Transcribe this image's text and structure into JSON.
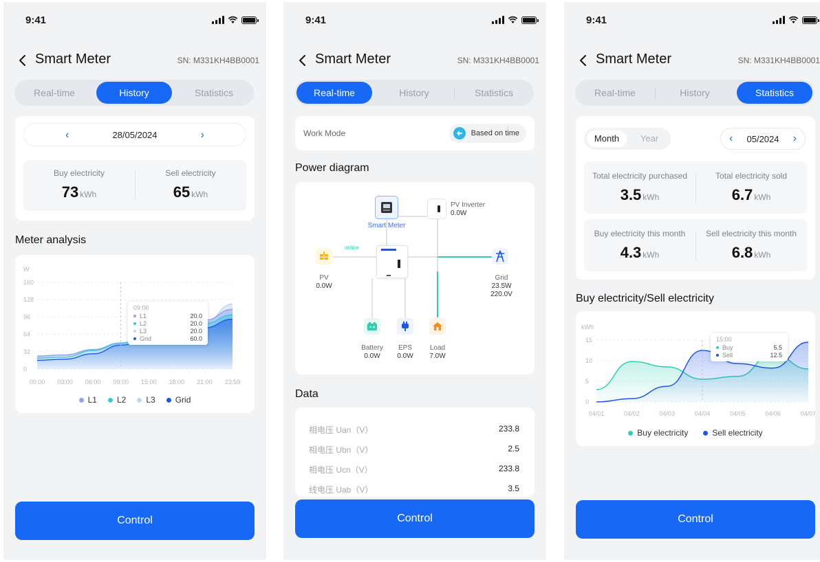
{
  "status": {
    "time": "9:41"
  },
  "header": {
    "title": "Smart Meter",
    "sn": "SN: M331KH4BB0001"
  },
  "tabs": [
    "Real-time",
    "History",
    "Statistics"
  ],
  "control_label": "Control",
  "history": {
    "date": "28/05/2024",
    "buy_label": "Buy electricity",
    "buy_value": "73",
    "sell_label": "Sell electricity",
    "sell_value": "65",
    "unit": "kWh",
    "analysis_title": "Meter analysis",
    "tooltip": {
      "time": "09:00",
      "rows": [
        {
          "name": "L1",
          "value": "20.0"
        },
        {
          "name": "L2",
          "value": "20.0"
        },
        {
          "name": "L3",
          "value": "20.0"
        },
        {
          "name": "Grid",
          "value": "60.0"
        }
      ]
    },
    "chart_data": {
      "type": "area",
      "ylabel": "W",
      "yticks": [
        "160",
        "128",
        "96",
        "64",
        "32",
        "0"
      ],
      "xticks": [
        "00:00",
        "03:00",
        "06:00",
        "09:00",
        "15:00",
        "18:00",
        "21:00",
        "23:59"
      ],
      "ylim": [
        0,
        160
      ],
      "legend": [
        "L1",
        "L2",
        "L3",
        "Grid"
      ],
      "colors": [
        "#8da4f0",
        "#3ec5e0",
        "#c5d3f3",
        "#1e57e8"
      ],
      "series": [
        {
          "name": "L1",
          "values": [
            24,
            26,
            36,
            48,
            62,
            76,
            90,
            110
          ]
        },
        {
          "name": "L2",
          "values": [
            20,
            22,
            34,
            48,
            60,
            72,
            84,
            100
          ]
        },
        {
          "name": "L3",
          "values": [
            22,
            25,
            35,
            46,
            58,
            70,
            86,
            120
          ]
        },
        {
          "name": "Grid",
          "values": [
            16,
            18,
            28,
            44,
            56,
            66,
            76,
            92
          ]
        }
      ]
    },
    "legend_colors": [
      "#8da4f0",
      "#3ec5e0",
      "#c5d3f3",
      "#1e57e8"
    ]
  },
  "realtime": {
    "work_mode_label": "Work Mode",
    "work_mode_value": "Based on time",
    "diagram_title": "Power diagram",
    "smart_meter": "Smart Meter",
    "pv_inverter": "PV Inverter",
    "pv_inverter_value": "0.0W",
    "online": "online",
    "pv": "PV",
    "pv_value": "0.0W",
    "grid": "Grid",
    "grid_power": "23.5W",
    "grid_voltage": "220.0V",
    "battery": "Battery",
    "battery_value": "0.0W",
    "eps": "EPS",
    "eps_value": "0.0W",
    "load": "Load",
    "load_value": "7.0W",
    "data_title": "Data",
    "data_rows": [
      {
        "k": "相电压 Uan（V）",
        "v": "233.8"
      },
      {
        "k": "相电压 Ubn（V）",
        "v": "2.5"
      },
      {
        "k": "相电压 Ucn（V）",
        "v": "233.8"
      },
      {
        "k": "线电压 Uab（V）",
        "v": "3.5"
      }
    ]
  },
  "statistics": {
    "period_tabs": [
      "Month",
      "Year"
    ],
    "month": "05/2024",
    "total_purchased_label": "Total electricity purchased",
    "total_purchased_value": "3.5",
    "total_sold_label": "Total electricity sold",
    "total_sold_value": "6.7",
    "month_buy_label": "Buy electricity this month",
    "month_buy_value": "4.3",
    "month_sell_label": "Sell electricity this month",
    "month_sell_value": "6.8",
    "unit": "kWh",
    "chart_title": "Buy electricity/Sell electricity",
    "tooltip": {
      "time": "15:00",
      "rows": [
        {
          "name": "Buy",
          "value": "5.5"
        },
        {
          "name": "Sell",
          "value": "12.5"
        }
      ]
    },
    "chart_data": {
      "type": "area",
      "ylabel": "kWh",
      "yticks": [
        "15",
        "10",
        "5",
        "0"
      ],
      "ylim": [
        0,
        15
      ],
      "categories": [
        "04/01",
        "04/02",
        "04/03",
        "04/04",
        "04/05",
        "04/06",
        "04/07"
      ],
      "colors": [
        "#2ecfb0",
        "#1e57e8"
      ],
      "series": [
        {
          "name": "Buy electricity",
          "values": [
            3,
            9.8,
            8.5,
            5.5,
            6.2,
            11.6,
            8
          ]
        },
        {
          "name": "Sell electricity",
          "values": [
            0,
            0.8,
            3.8,
            12.5,
            9.3,
            8.2,
            14.5
          ]
        }
      ]
    }
  }
}
